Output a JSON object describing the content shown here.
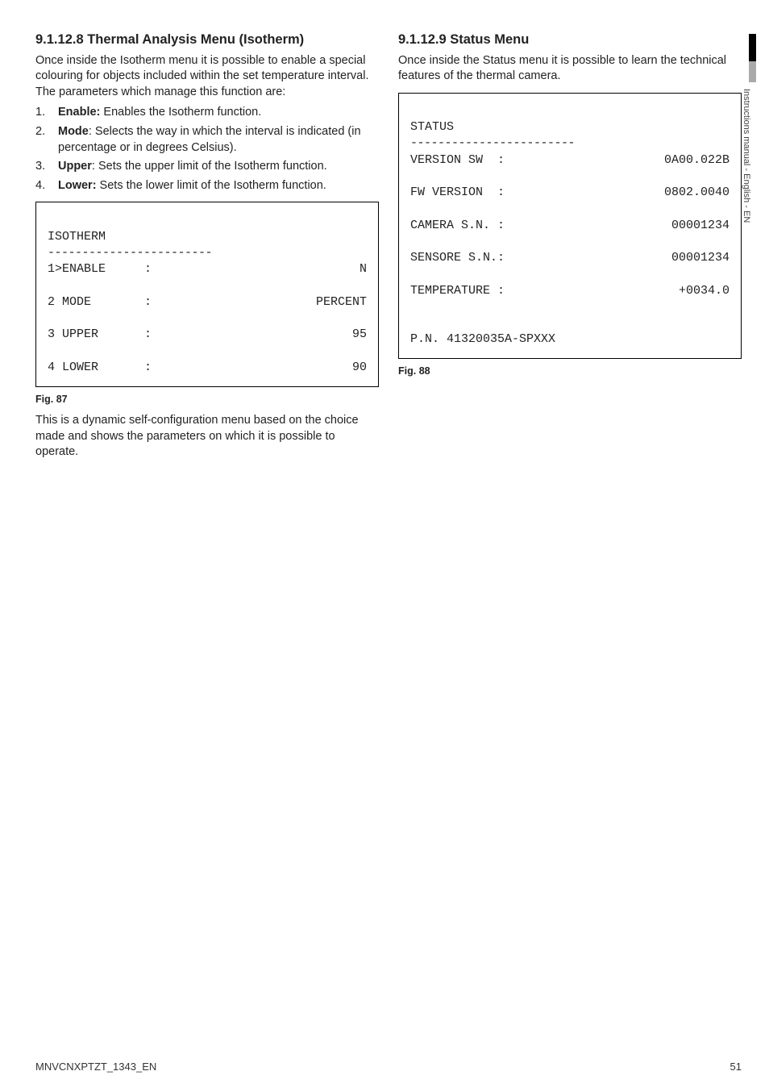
{
  "left": {
    "heading": "9.1.12.8 Thermal Analysis Menu (Isotherm)",
    "intro": "Once inside the Isotherm menu it is possible to enable a special colouring for objects included within the set temperature interval. The parameters which manage this function are:",
    "items": [
      {
        "num": "1.",
        "label": "Enable:",
        "text": " Enables the Isotherm function."
      },
      {
        "num": "2.",
        "label": "Mode",
        "text": ": Selects the way in which the interval is indicated (in percentage or in degrees Celsius)."
      },
      {
        "num": "3.",
        "label": "Upper",
        "text": ": Sets the upper limit of the Isotherm function."
      },
      {
        "num": "4.",
        "label": "Lower:",
        "text": " Sets the lower limit of the Isotherm function."
      }
    ],
    "term": {
      "title": "ISOTHERM",
      "rule": "------------------------",
      "rows": [
        {
          "label": "1>ENABLE",
          "colon": ":",
          "val": "N"
        },
        {
          "label": "2 MODE",
          "colon": ":",
          "val": "PERCENT"
        },
        {
          "label": "3 UPPER",
          "colon": ":",
          "val": "95"
        },
        {
          "label": "4 LOWER",
          "colon": ":",
          "val": "90"
        }
      ]
    },
    "fig": "Fig. 87",
    "after": "This is a dynamic self-configuration menu based on the choice made and shows the parameters on which it is possible to operate."
  },
  "right": {
    "heading": "9.1.12.9 Status Menu",
    "intro": "Once inside the Status menu it is possible to learn the technical features of the thermal camera.",
    "term": {
      "title": "STATUS",
      "rule": "------------------------",
      "rows": [
        {
          "label": "VERSION SW  :",
          "val": "0A00.022B"
        },
        {
          "label": "FW VERSION  :",
          "val": "0802.0040"
        },
        {
          "label": "CAMERA S.N. :",
          "val": "00001234"
        },
        {
          "label": "SENSORE S.N.:",
          "val": "00001234"
        },
        {
          "label": "TEMPERATURE :",
          "val": "+0034.0"
        }
      ],
      "pn": "P.N. 41320035A-SPXXX"
    },
    "fig": "Fig. 88"
  },
  "side_text": "Instructions manual - English - EN",
  "footer_left": "MNVCNXPTZT_1343_EN",
  "footer_right": "51"
}
